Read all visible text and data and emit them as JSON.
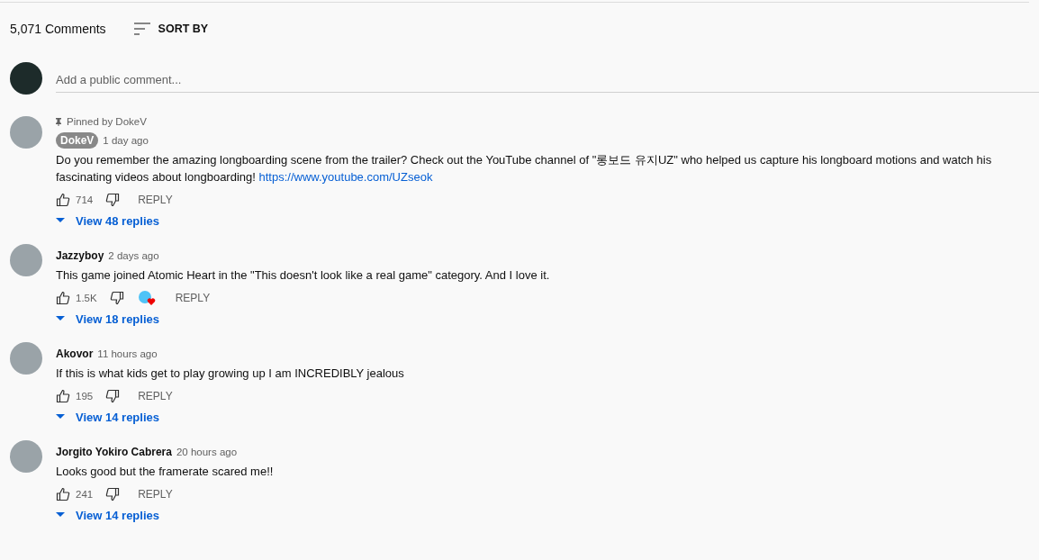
{
  "header": {
    "count": "5,071 Comments",
    "sort_label": "SORT BY"
  },
  "composer": {
    "placeholder": "Add a public comment..."
  },
  "comments": [
    {
      "pinned_label": "Pinned by DokeV",
      "author": "DokeV",
      "author_badge": true,
      "time": "1 day ago",
      "text": "Do you remember the amazing longboarding scene from the trailer? Check out the YouTube channel of \"롱보드 유지UZ\" who helped us capture his longboard motions and watch his fascinating videos about longboarding! ",
      "link": "https://www.youtube.com/UZseok",
      "likes": "714",
      "hearted": false,
      "reply_label": "REPLY",
      "replies": "View 48 replies"
    },
    {
      "author": "Jazzyboy",
      "author_badge": false,
      "time": "2 days ago",
      "text": "This game joined Atomic Heart in the \"This doesn't look like a real game\" category. And I love it.",
      "likes": "1.5K",
      "hearted": true,
      "reply_label": "REPLY",
      "replies": "View 18 replies"
    },
    {
      "author": "Akovor",
      "author_badge": false,
      "time": "11 hours ago",
      "text": "If this is what kids get to play growing up I am INCREDIBLY jealous",
      "likes": "195",
      "hearted": false,
      "reply_label": "REPLY",
      "replies": "View 14 replies"
    },
    {
      "author": "Jorgito Yokiro Cabrera",
      "author_badge": false,
      "time": "20 hours ago",
      "text": "Looks good but the framerate scared me!!",
      "likes": "241",
      "hearted": false,
      "reply_label": "REPLY",
      "replies": "View 14 replies"
    }
  ]
}
